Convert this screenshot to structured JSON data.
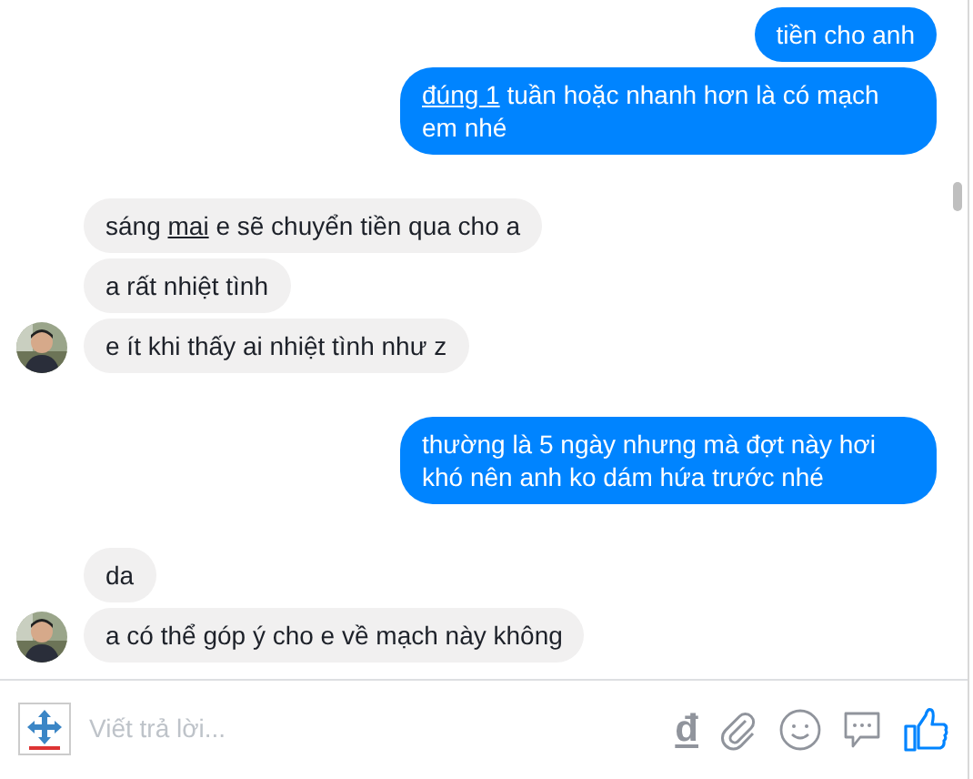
{
  "groups": [
    {
      "kind": "outgoing",
      "avatar": false,
      "messages": [
        [
          {
            "text": "tiền cho anh"
          }
        ],
        [
          {
            "text": "đúng 1",
            "link": true
          },
          {
            "text": " tuần hoặc nhanh hơn là có mạch em nhé"
          }
        ]
      ]
    },
    {
      "kind": "incoming",
      "avatar": true,
      "messages": [
        [
          {
            "text": "sáng "
          },
          {
            "text": "mai",
            "link": true
          },
          {
            "text": " e sẽ chuyển tiền qua cho a"
          }
        ],
        [
          {
            "text": "a rất nhiệt tình"
          }
        ],
        [
          {
            "text": "e ít khi thấy ai nhiệt tình như z"
          }
        ]
      ]
    },
    {
      "kind": "outgoing",
      "avatar": false,
      "messages": [
        [
          {
            "text": "thường là 5 ngày nhưng mà đợt này hơi khó nên anh ko dám hứa trước nhé"
          }
        ]
      ]
    },
    {
      "kind": "incoming",
      "avatar": true,
      "messages": [
        [
          {
            "text": "da"
          }
        ],
        [
          {
            "text": "a có thể góp ý cho e về mạch này không"
          }
        ]
      ]
    }
  ],
  "composer": {
    "placeholder": "Viết trả lời...",
    "currency_symbol": "đ"
  }
}
